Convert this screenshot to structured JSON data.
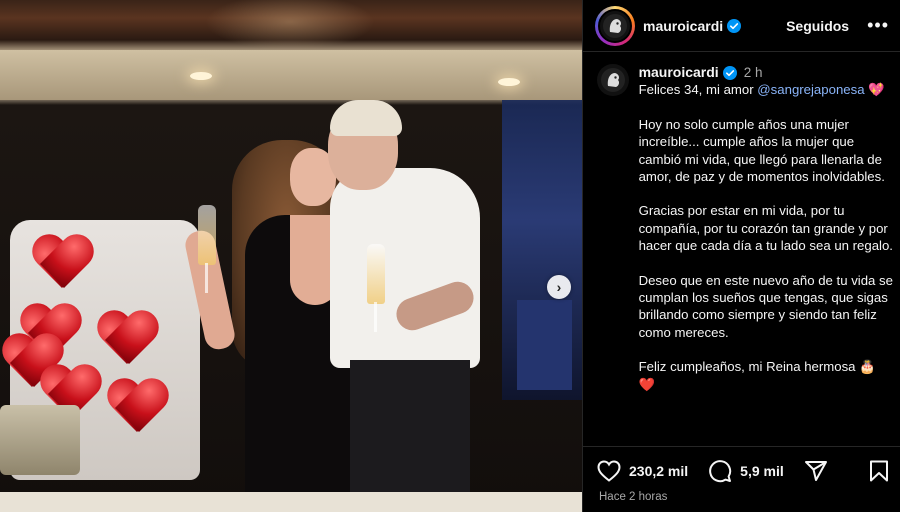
{
  "post": {
    "username": "mauroicardi",
    "follow_label": "Seguidos",
    "more_label": "•••",
    "time_short": "2 h",
    "caption_line1_prefix": "Felices 34, mi amor ",
    "mention": "@sangrejaponesa",
    "caption_emoji": "💖",
    "paragraphs": [
      "Hoy no solo cumple años una mujer increíble... cumple años la mujer que cambió mi vida, que llegó para llenarla de amor, de paz y de momentos inolvidables.",
      "Gracias por estar en mi vida, por tu compañía, por tu corazón tan grande y por hacer que cada día a tu lado sea un regalo.",
      "Deseo que en este nuevo año de tu vida se cumplan los sueños que tengas, que sigas brillando como siempre y siendo tan feliz como mereces."
    ],
    "closing_line": "Feliz cumpleaños, mi Reina hermosa 🎂",
    "closing_heart": "❤️",
    "likes": "230,2 mil",
    "comments": "5,9 mil",
    "time_long": "Hace 2 horas",
    "next_glyph": "›"
  },
  "colors": {
    "verified": "#0095f6",
    "mention": "#e0f1ff",
    "muted": "#a8a8a8"
  },
  "icons": [
    "verified-badge-icon",
    "heart-icon",
    "comment-icon",
    "share-icon",
    "bookmark-icon",
    "chevron-right-icon"
  ]
}
